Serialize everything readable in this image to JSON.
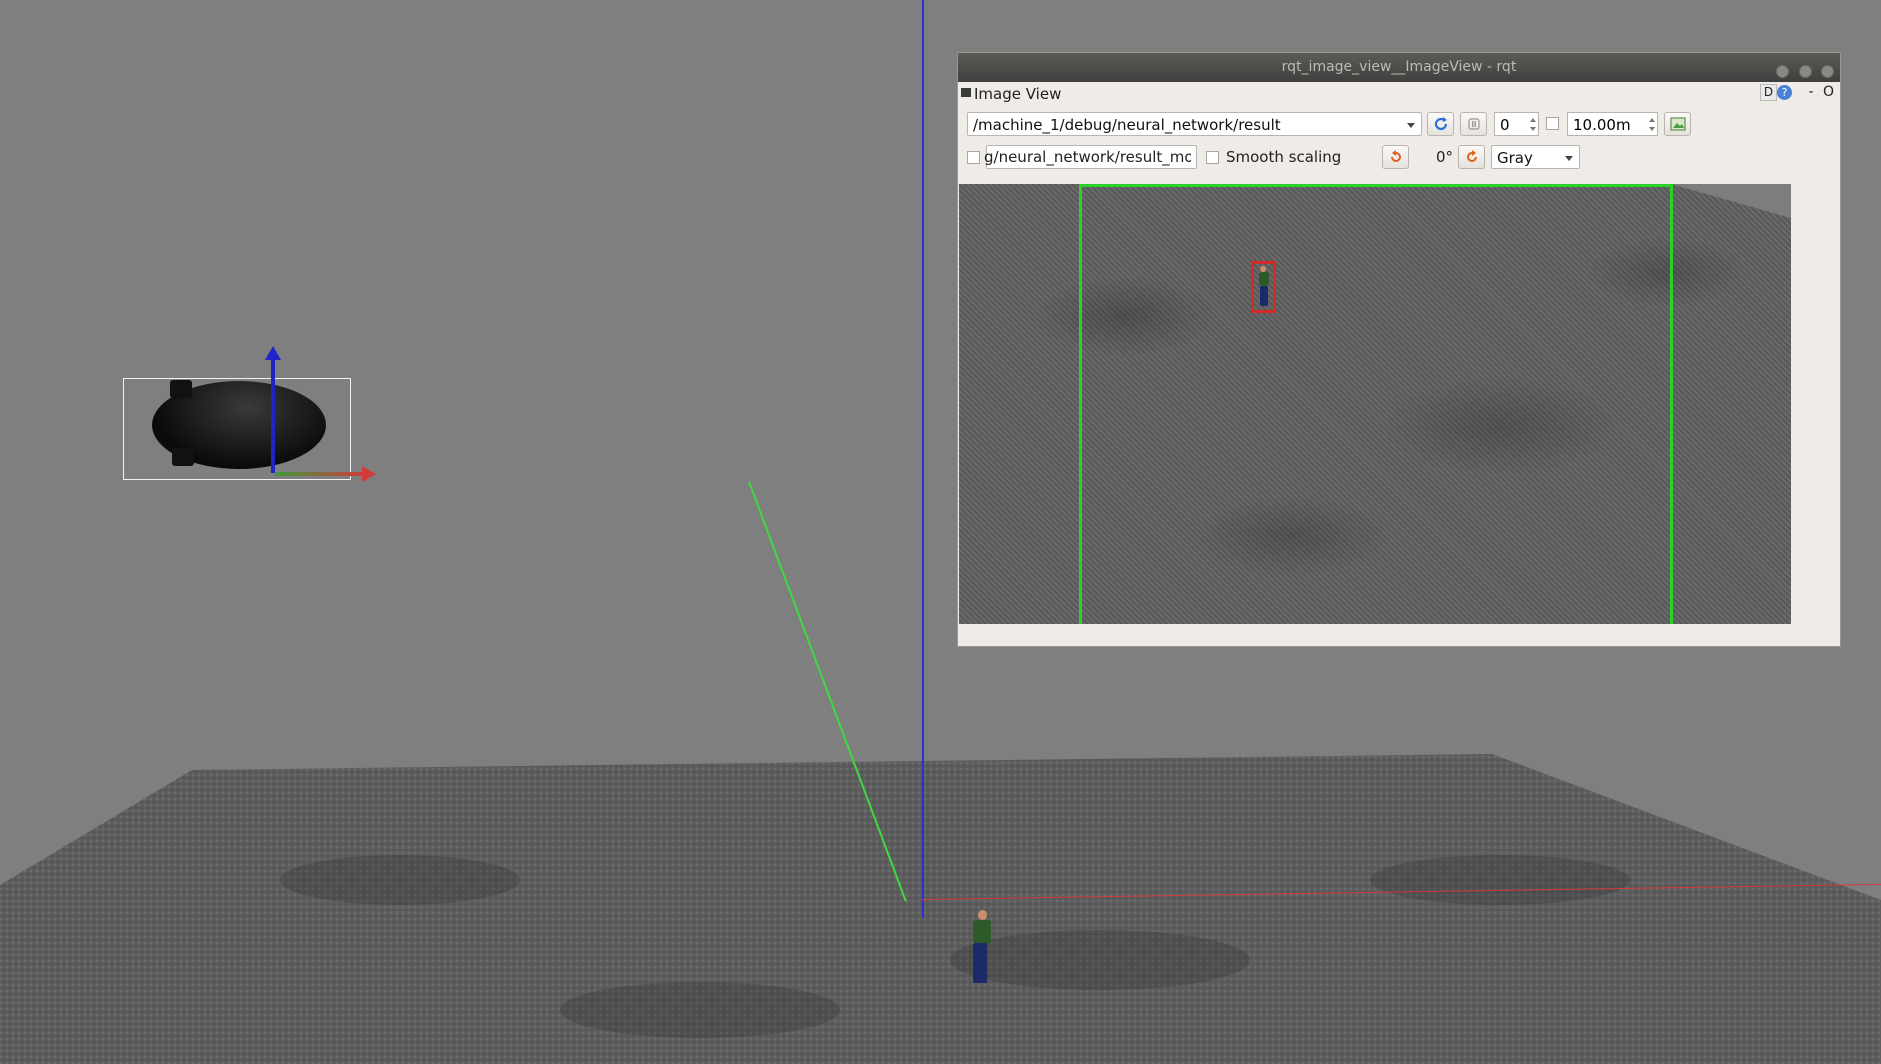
{
  "window": {
    "title": "rqt_image_view__ImageView - rqt"
  },
  "dock": {
    "title": "Image View",
    "d_label": "D",
    "help_label": "?",
    "minus_label": "-",
    "o_label": "O"
  },
  "toolbar": {
    "topic_selected": "/machine_1/debug/neural_network/result",
    "refresh_icon": "refresh-icon",
    "pause_icon": "pause-icon",
    "spin_value": "0",
    "duration_value": "10.00m",
    "save_icon": "save-image-icon"
  },
  "row2": {
    "mouse_topic_value": "g/neural_network/result_mouse_left",
    "smooth_scaling_label": "Smooth scaling",
    "rotate_left_icon": "rotate-ccw-icon",
    "rotation_value": "0°",
    "rotate_right_icon": "rotate-cw-icon",
    "color_scheme_selected": "Gray"
  },
  "colors": {
    "detection_box": "#2bd12b",
    "target_box": "#d62a2a",
    "scene_background": "#7f7f7f"
  }
}
